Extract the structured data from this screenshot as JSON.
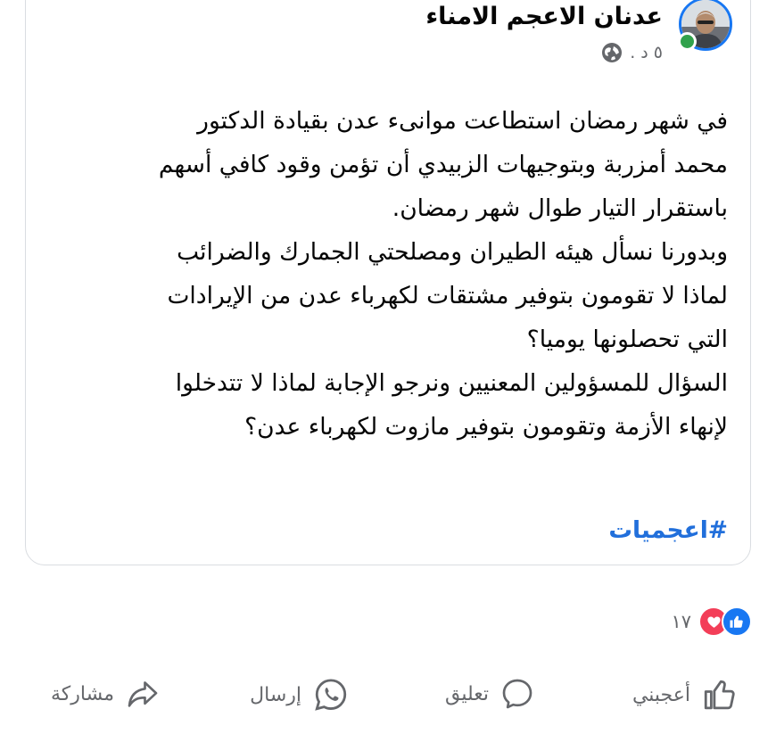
{
  "post": {
    "author": "عدنان الاعجم الامناء",
    "time": "٥ د .",
    "privacy_icon": "globe-icon",
    "text": "في شهر رمضان استطاعت موانىء عدن بقيادة الدكتور\nمحمد أمزربة وبتوجيهات الزبيدي أن تؤمن وقود كافي  أسهم\nباستقرار التيار طوال شهر رمضان.\nوبدورنا نسأل هيئه  الطيران  ومصلحتي الجمارك والضرائب\nلماذا لا تقومون بتوفير مشتقات لكهرباء عدن من الإيرادات\nالتي تحصلونها يوميا؟\nالسؤال للمسؤولين المعنيين  ونرجو الإجابة لماذا لا تتدخلوا\nلإنهاء الأزمة وتقومون بتوفير مازوت لكهرباء عدن؟",
    "hashtag": "#اعجميات"
  },
  "reactions": {
    "count": "١٧",
    "types": [
      "like",
      "love"
    ]
  },
  "actions": {
    "like": "أعجبني",
    "comment": "تعليق",
    "send": "إرسال",
    "share": "مشاركة"
  },
  "colors": {
    "accent": "#1877f2",
    "hashtag": "#216fdb",
    "love": "#f33e58",
    "online": "#31a24c",
    "muted": "#65676b"
  }
}
